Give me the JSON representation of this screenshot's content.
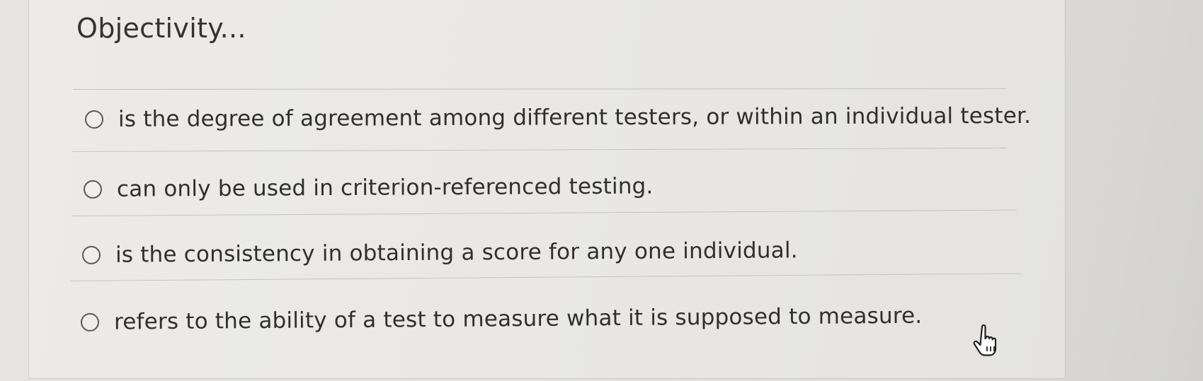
{
  "question": {
    "title": "Objectivity..."
  },
  "options": [
    {
      "label": "is the degree of agreement among different testers, or within an individual tester.",
      "selected": false
    },
    {
      "label": "can only be used in criterion-referenced testing.",
      "selected": false
    },
    {
      "label": "is the consistency in obtaining a score for any one individual.",
      "selected": false
    },
    {
      "label": "refers to the ability of a test to measure what it is supposed to measure.",
      "selected": false
    }
  ],
  "cursor": {
    "icon": "pointer-hand-icon"
  }
}
